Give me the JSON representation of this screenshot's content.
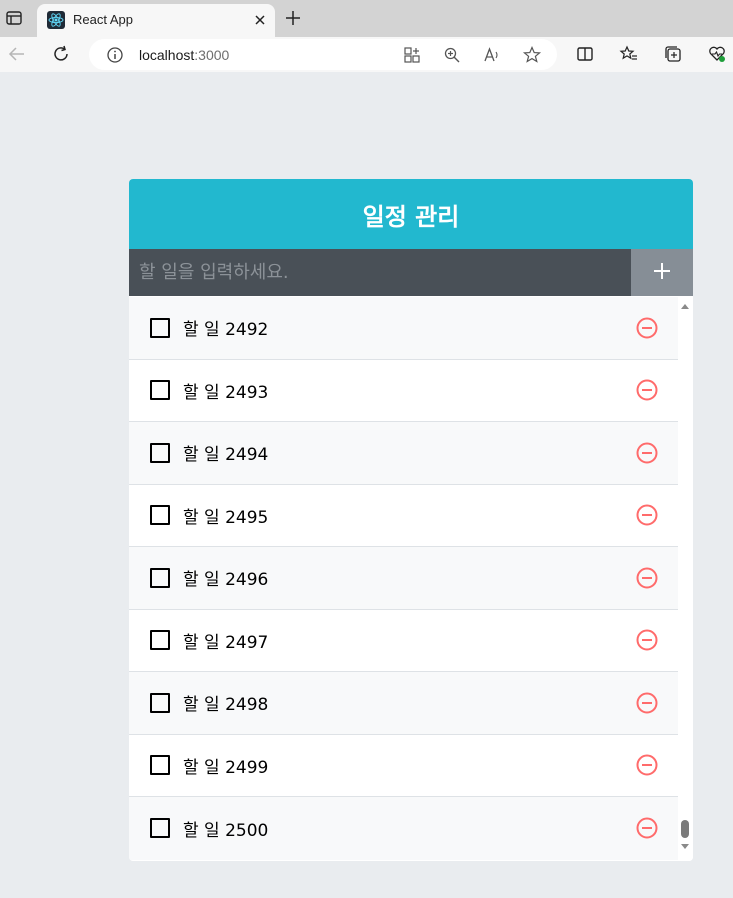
{
  "browser": {
    "tab_title": "React App",
    "address": "localhost",
    "address_port": ":3000"
  },
  "app": {
    "title": "일정 관리",
    "input_placeholder": "할 일을 입력하세요.",
    "todos": [
      {
        "text": "할 일 2492",
        "checked": false
      },
      {
        "text": "할 일 2493",
        "checked": false
      },
      {
        "text": "할 일 2494",
        "checked": false
      },
      {
        "text": "할 일 2495",
        "checked": false
      },
      {
        "text": "할 일 2496",
        "checked": false
      },
      {
        "text": "할 일 2497",
        "checked": false
      },
      {
        "text": "할 일 2498",
        "checked": false
      },
      {
        "text": "할 일 2499",
        "checked": false
      },
      {
        "text": "할 일 2500",
        "checked": false
      }
    ]
  },
  "colors": {
    "header": "#22b8cf",
    "insert_bg": "#495057",
    "add_button": "#868e96",
    "remove_icon": "#ff6b6b"
  }
}
